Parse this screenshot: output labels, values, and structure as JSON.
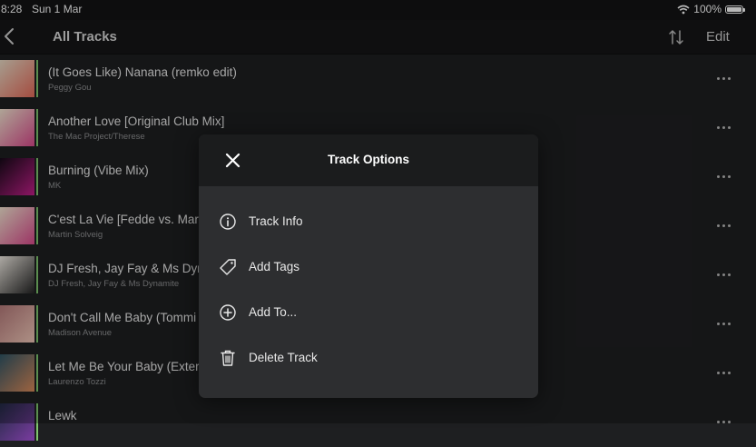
{
  "status": {
    "time": "8:28",
    "date": "Sun 1 Mar",
    "battery": "100%"
  },
  "nav": {
    "title": "All Tracks",
    "edit_label": "Edit"
  },
  "tracks": [
    {
      "title": "(It Goes Like) Nanana (remko edit)",
      "artist": "Peggy Gou",
      "art": [
        "#e8d9c4",
        "#e46b5a"
      ]
    },
    {
      "title": "Another Love [Original Club Mix]",
      "artist": "The Mac Project/Therese",
      "art": [
        "#f2e4d0",
        "#d94a8c"
      ]
    },
    {
      "title": "Burning (Vibe Mix)",
      "artist": "MK",
      "art": [
        "#160a18",
        "#c21f8a"
      ]
    },
    {
      "title": "C'est La Vie [Fedde vs. Mar",
      "artist": "Martin Solveig",
      "art": [
        "#f2e4d0",
        "#d94a8c"
      ]
    },
    {
      "title": "DJ Fresh, Jay Fay & Ms Dyna",
      "artist": "DJ Fresh, Jay Fay & Ms Dynamite",
      "art": [
        "#efeae2",
        "#222222"
      ]
    },
    {
      "title": "Don't Call Me Baby (Tommi",
      "artist": "Madison Avenue",
      "art": [
        "#b57a7a",
        "#f0c7b8"
      ]
    },
    {
      "title": "Let Me Be Your Baby (Exter",
      "artist": "Laurenzo Tozzi",
      "art": [
        "#2f5566",
        "#d98a5a"
      ]
    },
    {
      "title": "Lewk",
      "artist": "",
      "art": [
        "#222a44",
        "#7a3ca0"
      ]
    }
  ],
  "modal": {
    "title": "Track Options",
    "options": [
      {
        "label": "Track Info",
        "icon": "info-icon"
      },
      {
        "label": "Add Tags",
        "icon": "tag-icon"
      },
      {
        "label": "Add To...",
        "icon": "plus-circle-icon"
      },
      {
        "label": "Delete Track",
        "icon": "trash-icon"
      }
    ]
  },
  "colors": {
    "accent": "#7fc46e",
    "background": "#1e1f21",
    "modal": "#2d2e30"
  }
}
